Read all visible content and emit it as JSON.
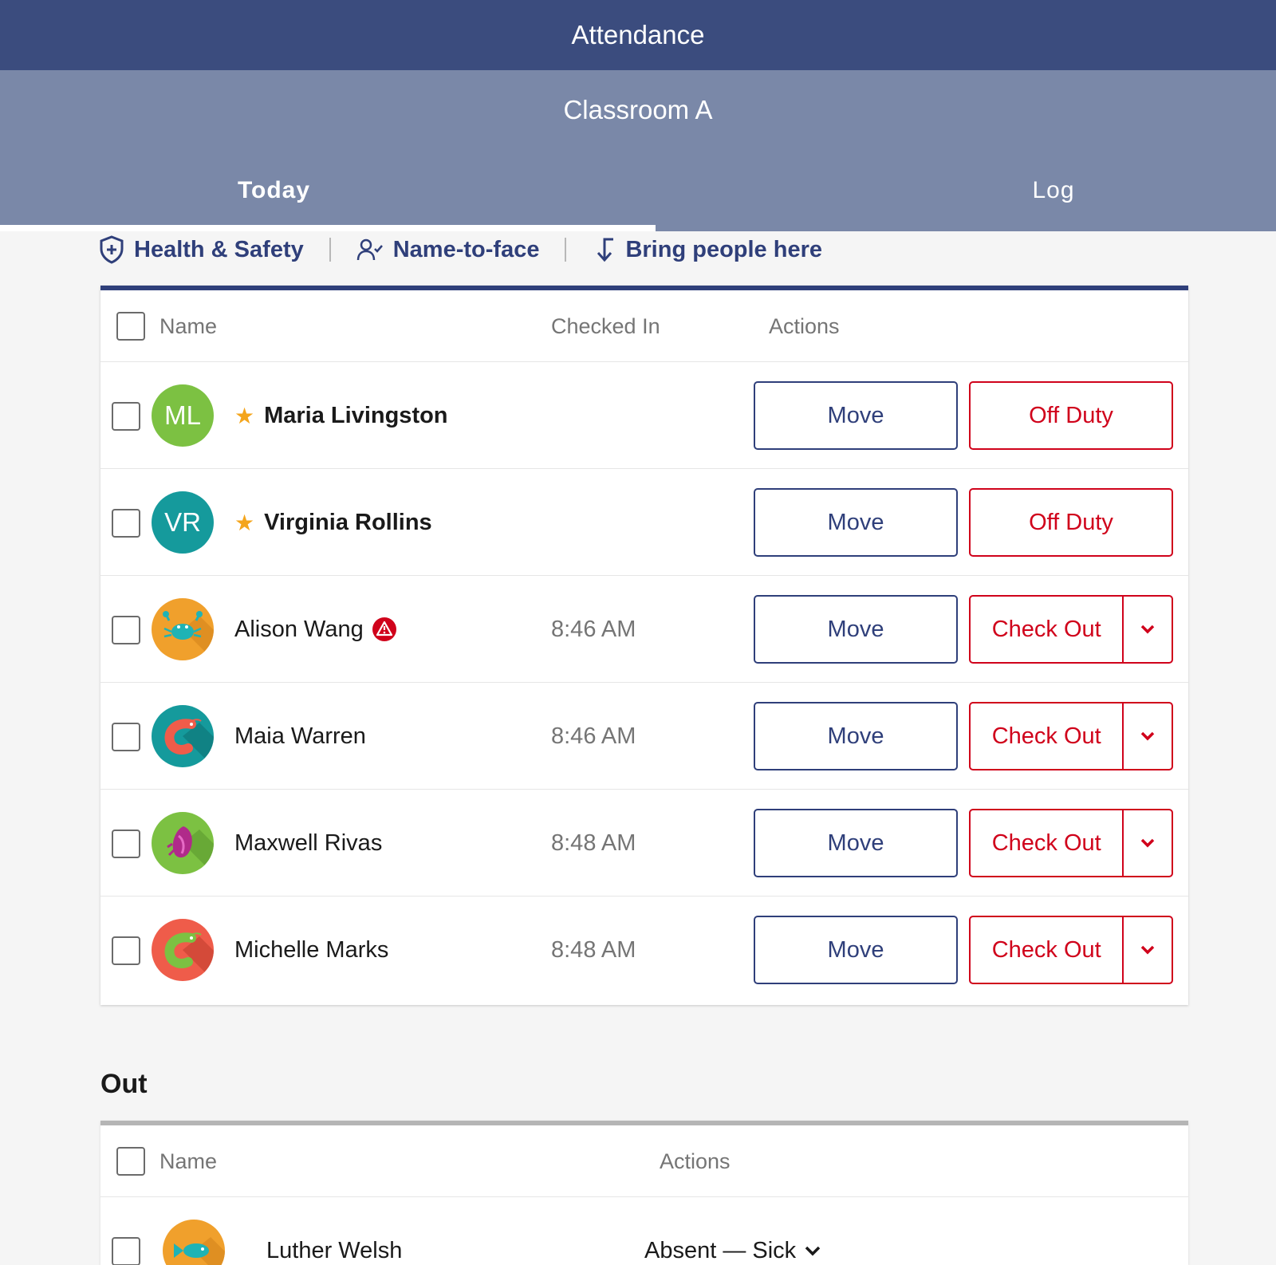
{
  "app": {
    "title": "Attendance"
  },
  "room": {
    "name": "Classroom A"
  },
  "tabs": {
    "today": "Today",
    "log": "Log"
  },
  "quicklinks": {
    "health": "Health & Safety",
    "name_to_face": "Name-to-face",
    "bring": "Bring people here"
  },
  "main_table": {
    "headers": {
      "name": "Name",
      "checked_in": "Checked In",
      "actions": "Actions"
    },
    "rows": [
      {
        "initials": "ML",
        "name": "Maria Livingston",
        "staff": true,
        "time": "",
        "move": "Move",
        "action": "Off Duty",
        "avatar_color": "#7cc142"
      },
      {
        "initials": "VR",
        "name": "Virginia Rollins",
        "staff": true,
        "time": "",
        "move": "Move",
        "action": "Off Duty",
        "avatar_color": "#159a9c"
      },
      {
        "name": "Alison Wang",
        "icon": "crab-icon",
        "alert": true,
        "time": "8:46 AM",
        "move": "Move",
        "action": "Check Out",
        "avatar_color": "#f0a02c"
      },
      {
        "name": "Maia Warren",
        "icon": "shrimp-icon",
        "time": "8:46 AM",
        "move": "Move",
        "action": "Check Out",
        "avatar_color": "#159a9c"
      },
      {
        "name": "Maxwell Rivas",
        "icon": "shell-icon",
        "time": "8:48 AM",
        "move": "Move",
        "action": "Check Out",
        "avatar_color": "#7cc142"
      },
      {
        "name": "Michelle Marks",
        "icon": "shrimp-icon",
        "time": "8:48 AM",
        "move": "Move",
        "action": "Check Out",
        "avatar_color": "#ef5c4a"
      }
    ]
  },
  "out_section": {
    "title": "Out",
    "headers": {
      "name": "Name",
      "actions": "Actions"
    },
    "rows": [
      {
        "name": "Luther Welsh",
        "icon": "fish-icon",
        "status": "Absent — Sick",
        "avatar_color": "#f0a02c"
      }
    ]
  },
  "colors": {
    "primary": "#2f3f7a",
    "header": "#3b4c7e",
    "subheader": "#7a88a8",
    "danger": "#d0021b",
    "star": "#f4a51c"
  }
}
